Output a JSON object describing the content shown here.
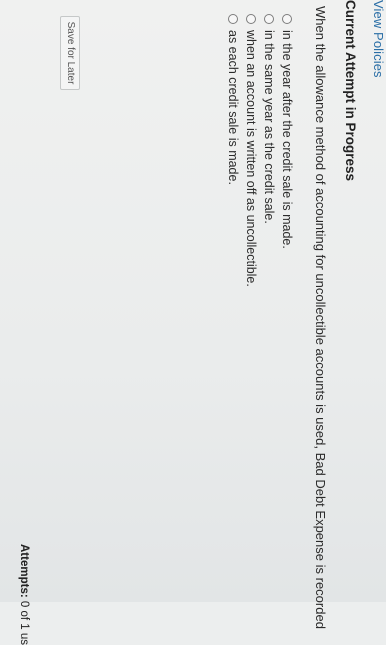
{
  "links": {
    "view_policies": "View Policies"
  },
  "section": {
    "heading": "Current Attempt in Progress"
  },
  "question": {
    "stem": "When the allowance method of accounting for uncollectible accounts is used, Bad Debt Expense is recorded",
    "options": [
      "in the year after the credit sale is made.",
      "in the same year as the credit sale.",
      "when an account is written off as uncollectible.",
      "as each credit sale is made."
    ]
  },
  "actions": {
    "save_later": "Save for Later"
  },
  "attempts": {
    "label": "Attempts:",
    "value": "0 of 1 us"
  }
}
